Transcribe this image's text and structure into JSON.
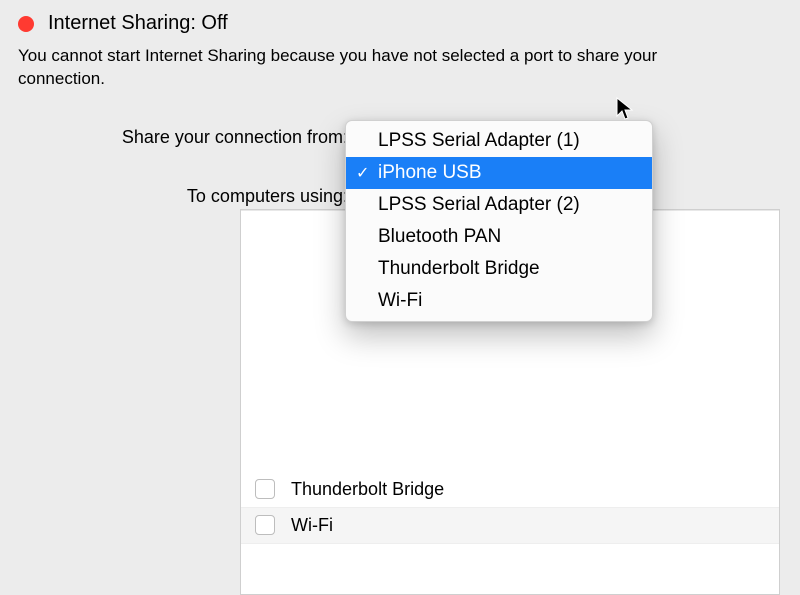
{
  "header": {
    "title": "Internet Sharing: Off",
    "status_color": "#ff3a31",
    "explanation": "You cannot start Internet Sharing because you have not selected a port to share your connection."
  },
  "labels": {
    "share_from": "Share your connection from:",
    "to_computers": "To computers using:"
  },
  "dropdown": {
    "options": [
      {
        "label": "LPSS Serial Adapter (1)",
        "selected": false
      },
      {
        "label": "iPhone USB",
        "selected": true
      },
      {
        "label": "LPSS Serial Adapter (2)",
        "selected": false
      },
      {
        "label": "Bluetooth PAN",
        "selected": false
      },
      {
        "label": "Thunderbolt Bridge",
        "selected": false
      },
      {
        "label": "Wi-Fi",
        "selected": false
      }
    ]
  },
  "ports": {
    "rows": [
      {
        "label": "Thunderbolt Bridge",
        "checked": false,
        "alt": false
      },
      {
        "label": "Wi-Fi",
        "checked": false,
        "alt": true
      }
    ]
  }
}
